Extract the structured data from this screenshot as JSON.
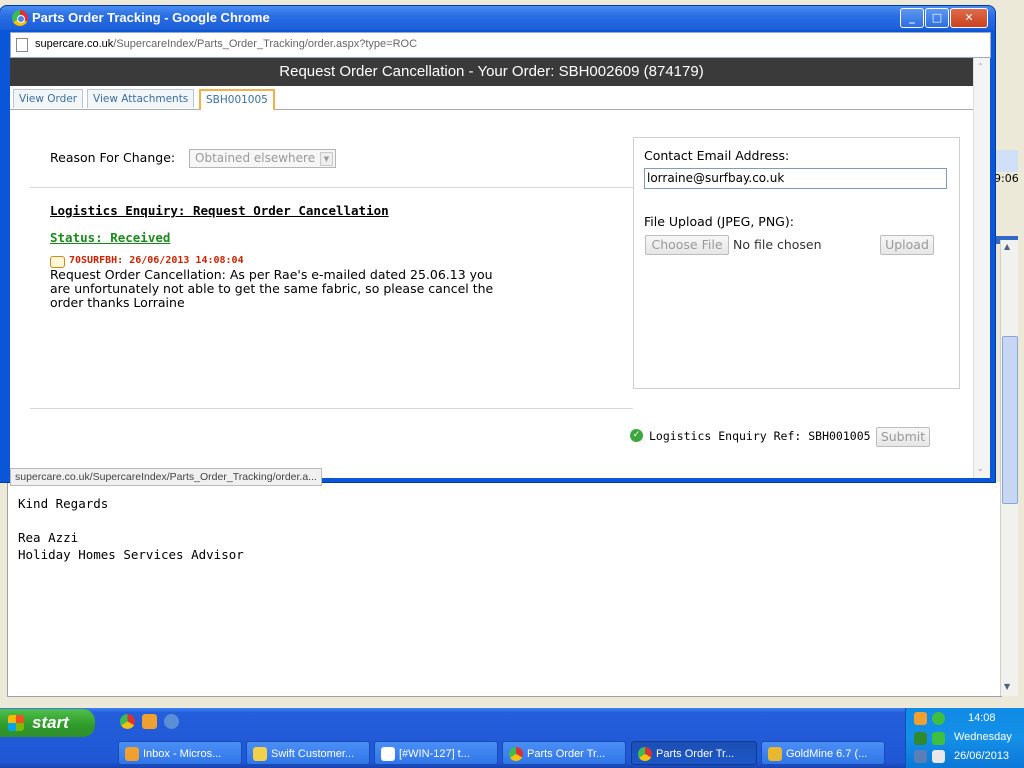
{
  "window": {
    "title": "Parts Order Tracking - Google Chrome",
    "url_host": "supercare.co.uk",
    "url_path": "/SupercareIndex/Parts_Order_Tracking/order.aspx?type=ROC",
    "controls": {
      "minimize": "_",
      "maximize": "□",
      "close": "✕"
    }
  },
  "header": {
    "title": "Request Order Cancellation - Your Order: SBH002609 (874179)"
  },
  "tabs": [
    {
      "label": "View Order",
      "active": false
    },
    {
      "label": "View Attachments",
      "active": false
    },
    {
      "label": "SBH001005",
      "active": true
    }
  ],
  "form": {
    "reason_label": "Reason For Change:",
    "reason_value": "Obtained elsewhere",
    "enquiry_title": "Logistics Enquiry: Request Order Cancellation",
    "status": "Status: Received",
    "note_meta": "70SURFBH: 26/06/2013 14:08:04",
    "note_body": "Request Order Cancellation: As per Rae's e-mailed dated 25.06.13 you are unfortunately not able to get the same fabric, so please cancel the order thanks Lorraine"
  },
  "side_panel": {
    "email_label": "Contact Email Address:",
    "email_value": "lorraine@surfbay.co.uk",
    "upload_label": "File Upload (JPEG, PNG):",
    "choose_file": "Choose File",
    "no_file": "No file chosen",
    "upload_button": "Upload"
  },
  "footer": {
    "ref_text": "Logistics Enquiry Ref: SBH001005",
    "submit_button": "Submit"
  },
  "status_bar_url": "supercare.co.uk/SupercareIndex/Parts_Order_Tracking/order.a...",
  "background_email": {
    "line1": "Kind Regards",
    "line2": "Rea Azzi",
    "line3": "Holiday Homes Services Advisor",
    "clock_fragment": "9:06"
  },
  "taskbar": {
    "start_label": "start",
    "tasks": [
      {
        "label": "Inbox - Micros...",
        "active": false,
        "icon_color": "#f0a030"
      },
      {
        "label": "Swift Customer...",
        "active": false,
        "icon_color": "#f3d04a"
      },
      {
        "label": "[#WIN-127] t...",
        "active": false,
        "icon_color": "#ffffff"
      },
      {
        "label": "Parts Order Tr...",
        "active": false,
        "icon_color": "#db3236"
      },
      {
        "label": "Parts Order Tr...",
        "active": true,
        "icon_color": "#db3236"
      },
      {
        "label": "GoldMine 6.7 (...",
        "active": false,
        "icon_color": "#e8b830"
      }
    ],
    "clock_time": "14:08",
    "clock_day": "Wednesday",
    "clock_date": "26/06/2013"
  }
}
